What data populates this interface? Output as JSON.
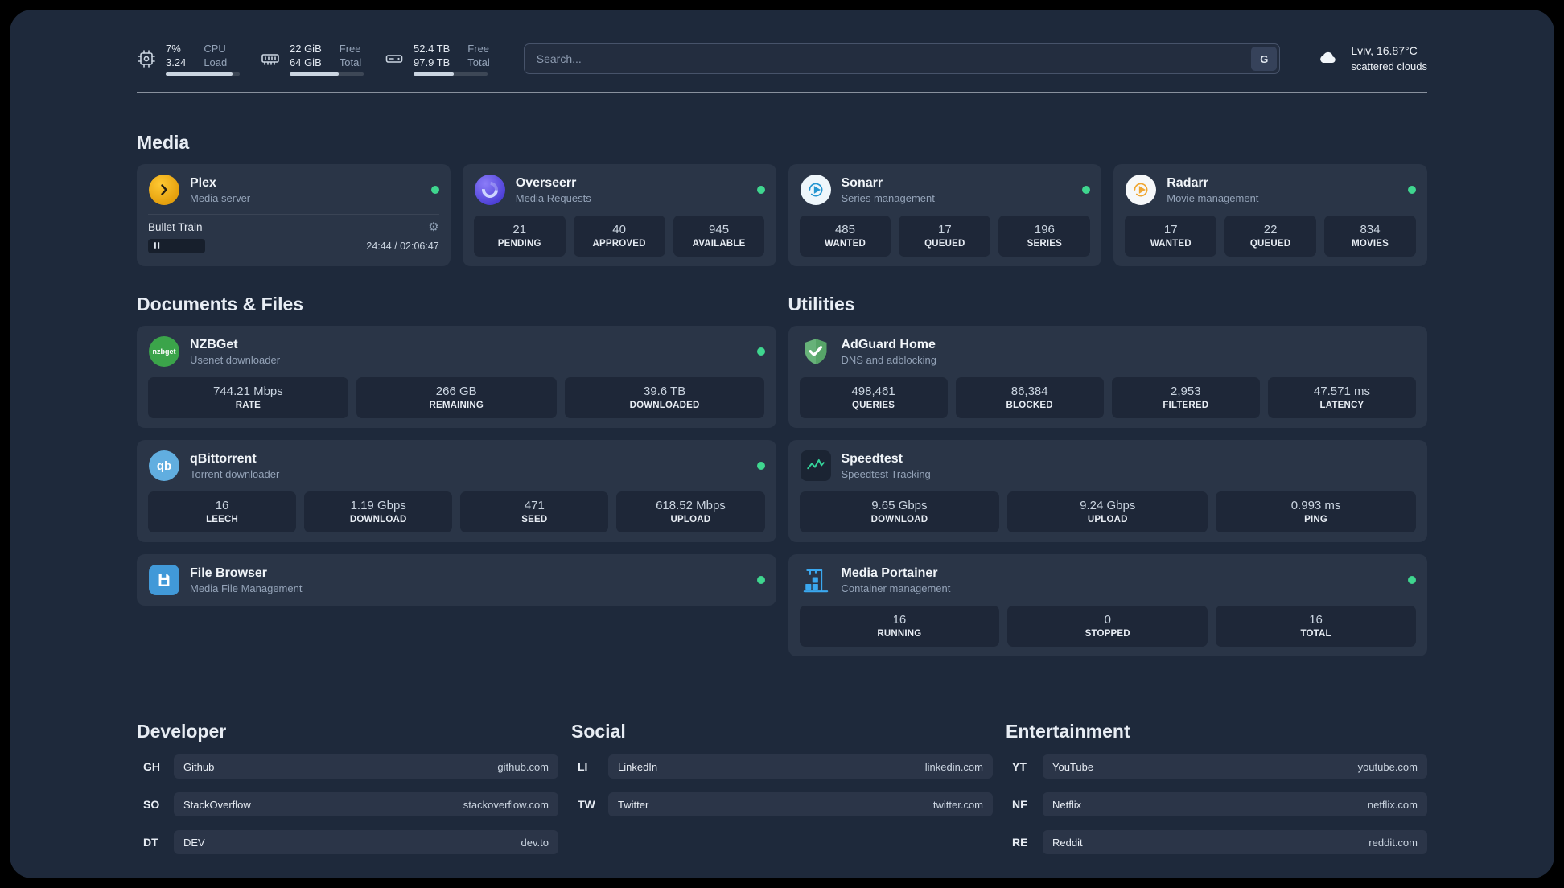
{
  "topbar": {
    "resources": [
      {
        "icon": "cpu-icon",
        "col1": [
          "7%",
          "3.24"
        ],
        "col2": [
          "CPU",
          "Load"
        ]
      },
      {
        "icon": "ram-icon",
        "col1": [
          "22 GiB",
          "64 GiB"
        ],
        "col2": [
          "Free",
          "Total"
        ]
      },
      {
        "icon": "disk-icon",
        "col1": [
          "52.4 TB",
          "97.9 TB"
        ],
        "col2": [
          "Free",
          "Total"
        ]
      }
    ],
    "search": {
      "placeholder": "Search...",
      "provider": "G"
    },
    "weather": {
      "icon": "cloud-icon",
      "location": "Lviv, 16.87°C",
      "condition": "scattered clouds"
    }
  },
  "media_section": {
    "title": "Media",
    "plex": {
      "name": "Plex",
      "desc": "Media server",
      "icon": "plex-icon",
      "now_playing": {
        "title": "Bullet Train",
        "time": "24:44 / 02:06:47"
      }
    },
    "overseerr": {
      "name": "Overseerr",
      "desc": "Media Requests",
      "icon": "overseerr-icon",
      "stats": [
        {
          "value": "21",
          "label": "PENDING"
        },
        {
          "value": "40",
          "label": "APPROVED"
        },
        {
          "value": "945",
          "label": "AVAILABLE"
        }
      ]
    },
    "sonarr": {
      "name": "Sonarr",
      "desc": "Series management",
      "icon": "sonarr-icon",
      "stats": [
        {
          "value": "485",
          "label": "WANTED"
        },
        {
          "value": "17",
          "label": "QUEUED"
        },
        {
          "value": "196",
          "label": "SERIES"
        }
      ]
    },
    "radarr": {
      "name": "Radarr",
      "desc": "Movie management",
      "icon": "radarr-icon",
      "stats": [
        {
          "value": "17",
          "label": "WANTED"
        },
        {
          "value": "22",
          "label": "QUEUED"
        },
        {
          "value": "834",
          "label": "MOVIES"
        }
      ]
    }
  },
  "documents_section": {
    "title": "Documents & Files",
    "nzbget": {
      "name": "NZBGet",
      "desc": "Usenet downloader",
      "icon": "nzbget-icon",
      "icon_text": "nzbget",
      "stats": [
        {
          "value": "744.21 Mbps",
          "label": "RATE"
        },
        {
          "value": "266 GB",
          "label": "REMAINING"
        },
        {
          "value": "39.6 TB",
          "label": "DOWNLOADED"
        }
      ]
    },
    "qbittorrent": {
      "name": "qBittorrent",
      "desc": "Torrent downloader",
      "icon": "qbittorrent-icon",
      "icon_text": "qb",
      "stats": [
        {
          "value": "16",
          "label": "LEECH"
        },
        {
          "value": "1.19 Gbps",
          "label": "DOWNLOAD"
        },
        {
          "value": "471",
          "label": "SEED"
        },
        {
          "value": "618.52 Mbps",
          "label": "UPLOAD"
        }
      ]
    },
    "filebrowser": {
      "name": "File Browser",
      "desc": "Media File Management",
      "icon": "filebrowser-icon"
    }
  },
  "utilities_section": {
    "title": "Utilities",
    "adguard": {
      "name": "AdGuard Home",
      "desc": "DNS and adblocking",
      "icon": "adguard-icon",
      "stats": [
        {
          "value": "498,461",
          "label": "QUERIES"
        },
        {
          "value": "86,384",
          "label": "BLOCKED"
        },
        {
          "value": "2,953",
          "label": "FILTERED"
        },
        {
          "value": "47.571 ms",
          "label": "LATENCY"
        }
      ]
    },
    "speedtest": {
      "name": "Speedtest",
      "desc": "Speedtest Tracking",
      "icon": "speedtest-icon",
      "stats": [
        {
          "value": "9.65 Gbps",
          "label": "DOWNLOAD"
        },
        {
          "value": "9.24 Gbps",
          "label": "UPLOAD"
        },
        {
          "value": "0.993 ms",
          "label": "PING"
        }
      ]
    },
    "portainer": {
      "name": "Media Portainer",
      "desc": "Container management",
      "icon": "portainer-icon",
      "stats": [
        {
          "value": "16",
          "label": "RUNNING"
        },
        {
          "value": "0",
          "label": "STOPPED"
        },
        {
          "value": "16",
          "label": "TOTAL"
        }
      ]
    }
  },
  "bookmarks": {
    "developer": {
      "title": "Developer",
      "items": [
        {
          "abbr": "GH",
          "name": "Github",
          "url": "github.com"
        },
        {
          "abbr": "SO",
          "name": "StackOverflow",
          "url": "stackoverflow.com"
        },
        {
          "abbr": "DT",
          "name": "DEV",
          "url": "dev.to"
        }
      ]
    },
    "social": {
      "title": "Social",
      "items": [
        {
          "abbr": "LI",
          "name": "LinkedIn",
          "url": "linkedin.com"
        },
        {
          "abbr": "TW",
          "name": "Twitter",
          "url": "twitter.com"
        }
      ]
    },
    "entertainment": {
      "title": "Entertainment",
      "items": [
        {
          "abbr": "YT",
          "name": "YouTube",
          "url": "youtube.com"
        },
        {
          "abbr": "NF",
          "name": "Netflix",
          "url": "netflix.com"
        },
        {
          "abbr": "RE",
          "name": "Reddit",
          "url": "reddit.com"
        }
      ]
    }
  },
  "colors": {
    "status_online": "#3fd68f",
    "accent_green": "#34d399",
    "panel_bg": "#1e293b"
  }
}
